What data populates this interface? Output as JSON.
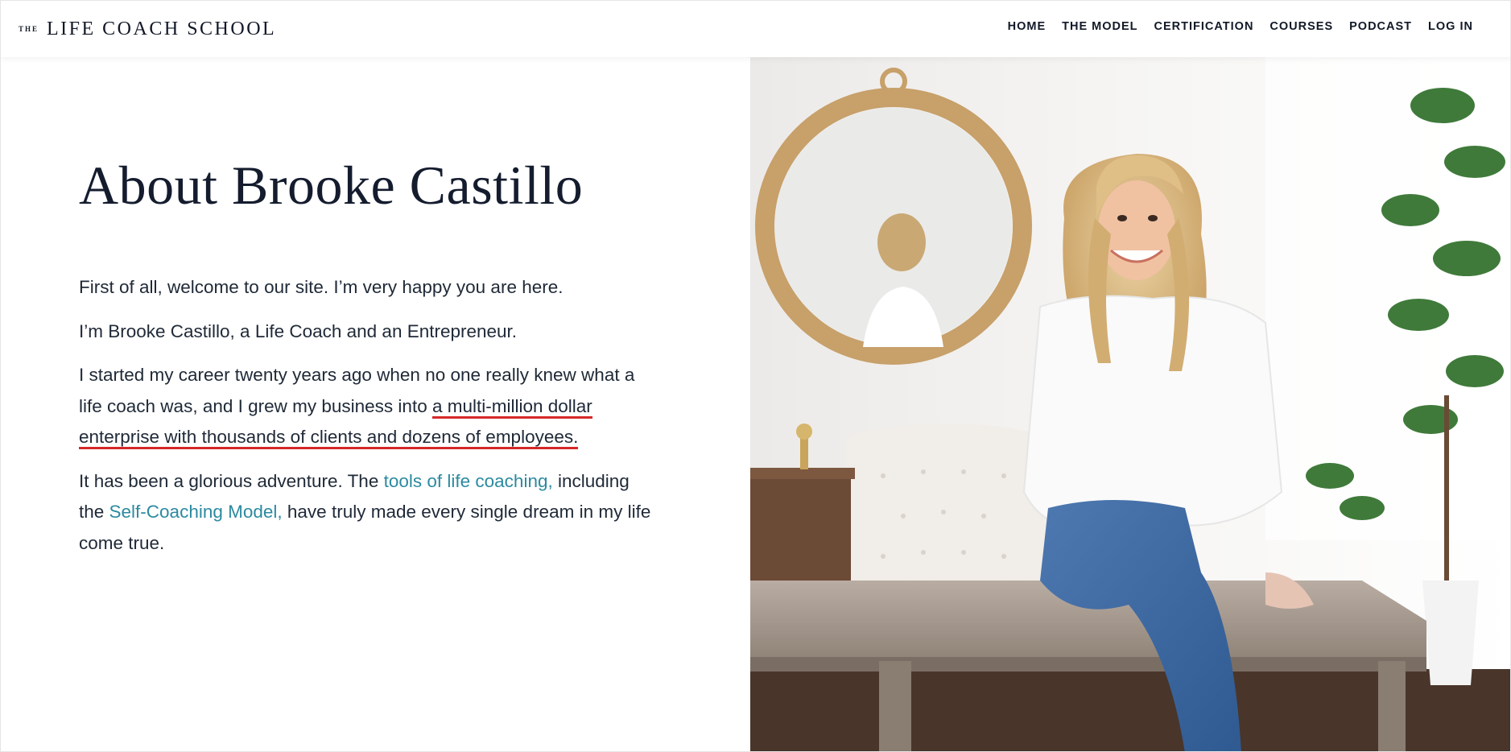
{
  "header": {
    "logo_small": "THE",
    "logo_main": "LIFE COACH SCHOOL",
    "nav": [
      "HOME",
      "THE MODEL",
      "CERTIFICATION",
      "COURSES",
      "PODCAST",
      "LOG IN"
    ]
  },
  "main": {
    "title": "About Brooke Castillo",
    "p1": "First of all, welcome to our site. I’m very happy you are here.",
    "p2": "I’m Brooke Castillo, a Life Coach and an Entrepreneur.",
    "p3_before": "I started my career twenty years ago when no one really knew what a life coach was, and I grew my business into ",
    "p3_highlight": "a multi-million dollar enterprise with thousands of clients and dozens of employees.",
    "p4_before": "It has been a glorious adventure. The ",
    "p4_link1": "tools of life coaching,",
    "p4_middle": " including the ",
    "p4_link2": "Self-Coaching Model,",
    "p4_after": " have truly made every single dream in my life come true."
  },
  "colors": {
    "text": "#1f2937",
    "link": "#2c8aa0",
    "underline": "#d62828"
  }
}
